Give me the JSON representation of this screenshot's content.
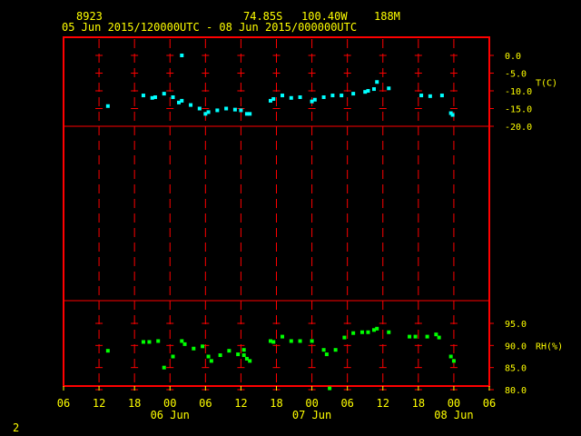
{
  "header": {
    "station_id": "8923",
    "latitude": "74.85S",
    "longitude": "100.40W",
    "elevation": "188M",
    "time_range": "05 Jun 2015/120000UTC - 08 Jun 2015/000000UTC"
  },
  "page_number": "2",
  "colors": {
    "frame": "#ff0000",
    "grid": "#ff0000",
    "text": "#ffff00",
    "temperature": "#00ffff",
    "humidity": "#00ff00"
  },
  "chart_data": [
    {
      "type": "scatter",
      "panel": "temperature",
      "ylabel": "T(C)",
      "ylim": [
        -20.0,
        0.0
      ],
      "yticks": [
        "0.0",
        "-5.0",
        "-10.0",
        "-15.0",
        "-20.0"
      ],
      "x_units": "hours since 06 Jun 00UTC",
      "points": [
        [
          -10.5,
          -14.3
        ],
        [
          -4.5,
          -11.3
        ],
        [
          -3.0,
          -12.0
        ],
        [
          -2.5,
          -11.8
        ],
        [
          -1.0,
          -10.8
        ],
        [
          0.5,
          -11.8
        ],
        [
          1.5,
          -13.3
        ],
        [
          2.0,
          0.0
        ],
        [
          2.0,
          -12.8
        ],
        [
          3.5,
          -14.0
        ],
        [
          5.0,
          -15.0
        ],
        [
          6.0,
          -16.5
        ],
        [
          6.5,
          -16.0
        ],
        [
          8.0,
          -15.5
        ],
        [
          9.5,
          -15.0
        ],
        [
          11.0,
          -15.3
        ],
        [
          12.0,
          -15.5
        ],
        [
          13.0,
          -16.5
        ],
        [
          13.5,
          -16.5
        ],
        [
          17.0,
          -12.8
        ],
        [
          17.5,
          -12.3
        ],
        [
          19.0,
          -11.3
        ],
        [
          20.5,
          -12.0
        ],
        [
          22.0,
          -11.8
        ],
        [
          24.0,
          -13.0
        ],
        [
          24.5,
          -12.5
        ],
        [
          26.0,
          -11.8
        ],
        [
          27.5,
          -11.3
        ],
        [
          29.0,
          -11.3
        ],
        [
          31.0,
          -10.8
        ],
        [
          33.0,
          -10.3
        ],
        [
          33.5,
          -10.0
        ],
        [
          34.5,
          -9.5
        ],
        [
          35.0,
          -7.5
        ],
        [
          37.0,
          -9.3
        ],
        [
          42.5,
          -11.3
        ],
        [
          44.0,
          -11.5
        ],
        [
          46.0,
          -11.3
        ],
        [
          47.5,
          -16.3
        ],
        [
          47.8,
          -16.8
        ]
      ]
    },
    {
      "type": "scatter",
      "panel": "relative-humidity",
      "ylabel": "RH(%)",
      "ylim": [
        80.0,
        95.0
      ],
      "yticks": [
        "95.0",
        "90.0",
        "85.0",
        "80.0"
      ],
      "x_units": "hours since 06 Jun 00UTC",
      "points": [
        [
          -10.5,
          88.8
        ],
        [
          -4.5,
          90.8
        ],
        [
          -3.5,
          90.8
        ],
        [
          -2.0,
          91.0
        ],
        [
          -1.0,
          85.0
        ],
        [
          0.5,
          87.5
        ],
        [
          2.0,
          91.0
        ],
        [
          2.5,
          90.3
        ],
        [
          4.0,
          89.3
        ],
        [
          5.5,
          89.8
        ],
        [
          6.5,
          87.5
        ],
        [
          7.0,
          86.5
        ],
        [
          8.5,
          87.8
        ],
        [
          10.0,
          88.8
        ],
        [
          11.5,
          88.0
        ],
        [
          12.5,
          89.0
        ],
        [
          12.5,
          87.8
        ],
        [
          13.0,
          87.0
        ],
        [
          13.5,
          86.5
        ],
        [
          17.0,
          91.0
        ],
        [
          17.5,
          90.8
        ],
        [
          19.0,
          92.0
        ],
        [
          20.5,
          91.0
        ],
        [
          22.0,
          91.0
        ],
        [
          24.0,
          91.0
        ],
        [
          26.0,
          89.0
        ],
        [
          26.5,
          88.0
        ],
        [
          27.0,
          80.3
        ],
        [
          28.0,
          89.0
        ],
        [
          29.5,
          91.8
        ],
        [
          31.0,
          92.8
        ],
        [
          32.5,
          93.0
        ],
        [
          33.5,
          93.0
        ],
        [
          34.5,
          93.5
        ],
        [
          35.0,
          93.8
        ],
        [
          37.0,
          93.0
        ],
        [
          40.5,
          92.0
        ],
        [
          41.5,
          92.0
        ],
        [
          43.5,
          92.0
        ],
        [
          45.0,
          92.5
        ],
        [
          45.5,
          91.8
        ],
        [
          47.5,
          87.5
        ],
        [
          48.0,
          86.5
        ]
      ]
    }
  ],
  "x_axis": {
    "range_hours": [
      -18,
      54
    ],
    "tick_labels": [
      "06",
      "12",
      "18",
      "00",
      "06",
      "12",
      "18",
      "00",
      "06",
      "12",
      "18",
      "00",
      "06"
    ],
    "day_labels": [
      {
        "text": "06 Jun",
        "hour": 0
      },
      {
        "text": "07 Jun",
        "hour": 24
      },
      {
        "text": "08 Jun",
        "hour": 48
      }
    ]
  }
}
